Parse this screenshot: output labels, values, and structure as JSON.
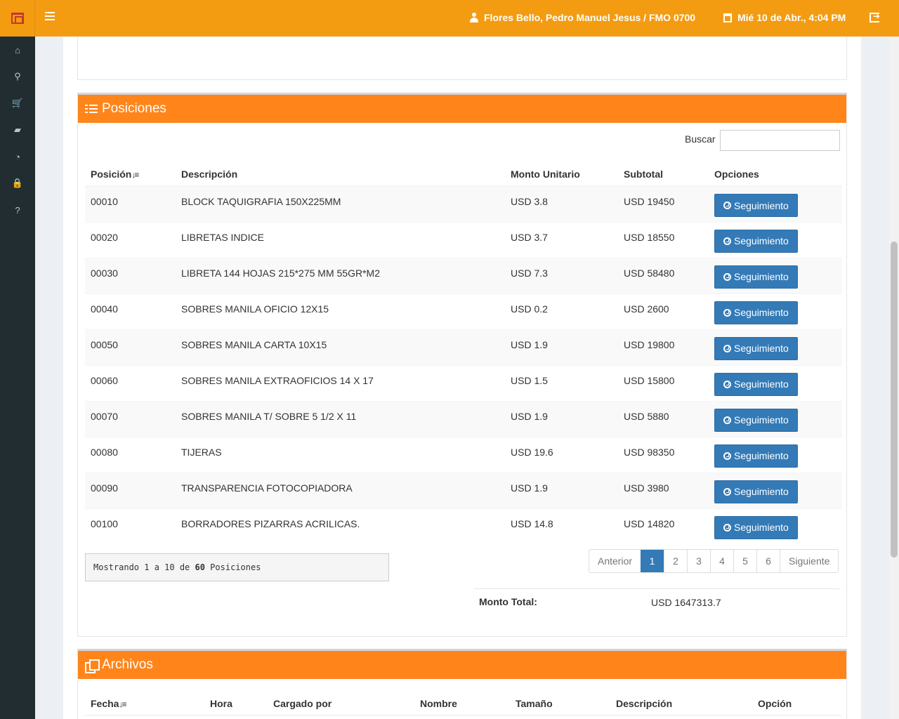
{
  "header": {
    "user": "Flores Bello, Pedro Manuel Jesus / FMO 0700",
    "datetime": "Mié 10 de Abr., 4:04 PM"
  },
  "sidebar": {
    "icons": [
      "home-icon",
      "search-icon",
      "cart-icon",
      "truck-icon",
      "pie-chart-icon",
      "lock-icon",
      "question-icon"
    ]
  },
  "posiciones": {
    "title": "Posiciones",
    "search_label": "Buscar",
    "search_value": "",
    "columns": [
      "Posición",
      "Descripción",
      "Monto Unitario",
      "Subtotal",
      "Opciones"
    ],
    "button_label": "Seguimiento",
    "rows": [
      {
        "pos": "00010",
        "desc": "BLOCK TAQUIGRAFIA 150X225MM",
        "unit": "USD 3.8",
        "subtotal": "USD 19450"
      },
      {
        "pos": "00020",
        "desc": "LIBRETAS INDICE",
        "unit": "USD 3.7",
        "subtotal": "USD 18550"
      },
      {
        "pos": "00030",
        "desc": "LIBRETA 144 HOJAS 215*275 MM 55GR*M2",
        "unit": "USD 7.3",
        "subtotal": "USD 58480"
      },
      {
        "pos": "00040",
        "desc": "SOBRES MANILA OFICIO 12X15",
        "unit": "USD 0.2",
        "subtotal": "USD 2600"
      },
      {
        "pos": "00050",
        "desc": "SOBRES MANILA CARTA 10X15",
        "unit": "USD 1.9",
        "subtotal": "USD 19800"
      },
      {
        "pos": "00060",
        "desc": "SOBRES MANILA EXTRAOFICIOS 14 X 17",
        "unit": "USD 1.5",
        "subtotal": "USD 15800"
      },
      {
        "pos": "00070",
        "desc": "SOBRES MANILA T/ SOBRE 5 1/2 X 11",
        "unit": "USD 1.9",
        "subtotal": "USD 5880"
      },
      {
        "pos": "00080",
        "desc": "TIJERAS",
        "unit": "USD 19.6",
        "subtotal": "USD 98350"
      },
      {
        "pos": "00090",
        "desc": "TRANSPARENCIA FOTOCOPIADORA",
        "unit": "USD 1.9",
        "subtotal": "USD 3980"
      },
      {
        "pos": "00100",
        "desc": "BORRADORES PIZARRAS ACRILICAS.",
        "unit": "USD 14.8",
        "subtotal": "USD 14820"
      }
    ],
    "info": {
      "prefix": "Mostrando 1 a 10 de ",
      "count": "60",
      "suffix": " Posiciones"
    },
    "pagination": {
      "prev": "Anterior",
      "pages": [
        "1",
        "2",
        "3",
        "4",
        "5",
        "6"
      ],
      "active": "1",
      "next": "Siguiente"
    },
    "total_label": "Monto Total:",
    "total_value": "USD 1647313.7"
  },
  "archivos": {
    "title": "Archivos",
    "columns": [
      "Fecha",
      "Hora",
      "Cargado por",
      "Nombre",
      "Tamaño",
      "Descripción",
      "Opción"
    ]
  },
  "colors": {
    "header": "#f39c12",
    "panel_header": "#ff851b",
    "sidebar": "#222d32",
    "button": "#337ab7"
  }
}
